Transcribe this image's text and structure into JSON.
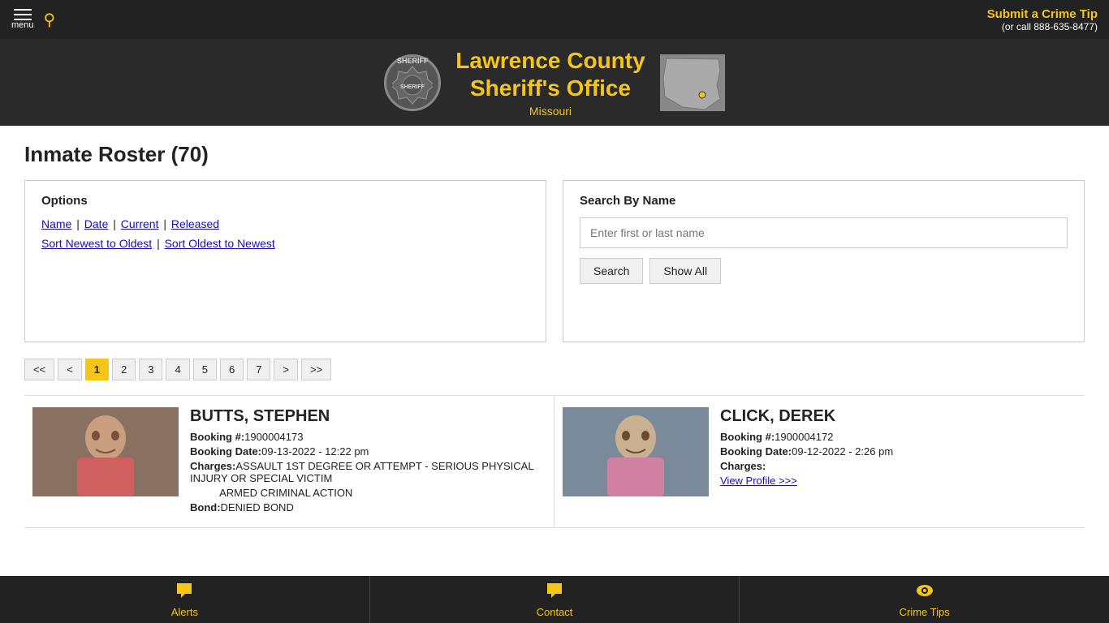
{
  "topbar": {
    "menu_label": "menu",
    "crime_tip_text": "Submit a Crime Tip",
    "crime_tip_phone": "(or call 888-635-8477)"
  },
  "header": {
    "title_line1": "Lawrence County",
    "title_line2": "Sheriff's Office",
    "state": "Missouri",
    "badge_text": "SHERIFF"
  },
  "page": {
    "title": "Inmate Roster (70)"
  },
  "options": {
    "title": "Options",
    "links": [
      {
        "label": "Name",
        "id": "name"
      },
      {
        "label": "Date",
        "id": "date"
      },
      {
        "label": "Current",
        "id": "current"
      },
      {
        "label": "Released",
        "id": "released"
      }
    ],
    "sort_newest": "Sort Newest to Oldest",
    "sort_oldest": "Sort Oldest to Newest"
  },
  "search": {
    "title": "Search By Name",
    "placeholder": "Enter first or last name",
    "search_btn": "Search",
    "show_all_btn": "Show All"
  },
  "pagination": {
    "first": "<<",
    "prev": "<",
    "next": ">",
    "last": ">>",
    "pages": [
      "1",
      "2",
      "3",
      "4",
      "5",
      "6",
      "7"
    ],
    "current": "1"
  },
  "inmates": [
    {
      "name": "BUTTS, STEPHEN",
      "booking_num": "1900004173",
      "booking_date": "09-13-2022 - 12:22 pm",
      "charges_label": "Charges:",
      "charges": "ASSAULT 1ST DEGREE OR ATTEMPT - SERIOUS PHYSICAL INJURY OR SPECIAL VICTIM\nARMED CRIMINAL ACTION",
      "bond_label": "Bond:",
      "bond": "DENIED BOND",
      "has_photo": true,
      "photo_color": "#a0855a"
    },
    {
      "name": "CLICK, DEREK",
      "booking_num": "1900004172",
      "booking_date": "09-12-2022 - 2:26 pm",
      "charges_label": "Charges:",
      "charges": "",
      "view_profile": "View Profile >>>",
      "has_photo": true,
      "photo_color": "#8a9ab0"
    }
  ],
  "bottom_nav": [
    {
      "id": "alerts",
      "icon": "💬",
      "label": "Alerts"
    },
    {
      "id": "contact",
      "icon": "💬",
      "label": "Contact"
    },
    {
      "id": "crime-tips",
      "icon": "👁",
      "label": "Crime Tips"
    }
  ]
}
